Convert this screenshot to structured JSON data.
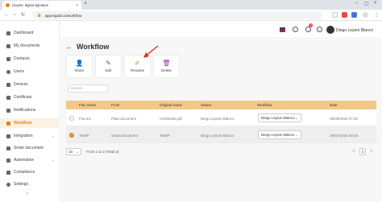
{
  "browser": {
    "tab_title": "Lleyeto: digital signature",
    "url": "app.legado.io/workflow"
  },
  "sidebar": {
    "items": [
      {
        "label": "Dashboard",
        "icon": "grid-icon"
      },
      {
        "label": "My documents",
        "icon": "folder-icon"
      },
      {
        "label": "Contacts",
        "icon": "contacts-icon"
      },
      {
        "label": "Users",
        "icon": "user-icon"
      },
      {
        "label": "Devices",
        "icon": "device-icon"
      },
      {
        "label": "Certificate",
        "icon": "certificate-icon"
      },
      {
        "label": "Notifications",
        "icon": "bell-icon"
      },
      {
        "label": "Workflow",
        "icon": "workflow-icon",
        "active": true
      },
      {
        "label": "Integration",
        "icon": "integration-icon",
        "expandable": true
      },
      {
        "label": "Smart document",
        "icon": "smart-document-icon"
      },
      {
        "label": "Automation",
        "icon": "automation-icon",
        "expandable": true
      },
      {
        "label": "Compliance",
        "icon": "compliance-icon"
      },
      {
        "label": "Settings",
        "icon": "gear-icon"
      }
    ],
    "collapse_icon": "chevron-left-icon"
  },
  "header": {
    "user_name": "Diego Leyton Blanco",
    "notification_count": "2",
    "language_flag": "us-flag-icon"
  },
  "page": {
    "title": "Workflow",
    "actions": [
      {
        "label": "Share",
        "icon": "share-user-icon"
      },
      {
        "label": "Edit",
        "icon": "edit-icon"
      },
      {
        "label": "Rename",
        "icon": "rename-icon"
      },
      {
        "label": "Delete",
        "icon": "delete-icon"
      }
    ],
    "search_placeholder": "Search"
  },
  "table": {
    "columns": [
      "Flux name",
      "From",
      "Original name",
      "Owner",
      "Workflow",
      "Date"
    ],
    "rows": [
      {
        "selected": false,
        "flux_name": "Flux Ex",
        "from": "Plain document",
        "original_name": "Certificate.pdf",
        "owner": "Diego Leyton Blanco",
        "workflow": "Diego Leyton Blanco",
        "date": "05/09/2023 07:02"
      },
      {
        "selected": true,
        "flux_name": "TEMP",
        "from": "Smart document",
        "original_name": "TEMP",
        "owner": "Diego Leyton Blanco",
        "workflow": "Diego Leyton Blanco",
        "date": "29/07/2024 09:49"
      }
    ]
  },
  "pagination": {
    "page_size": "10",
    "range_text": "From 1 to 2 (Total 2)",
    "current_page": "1",
    "prev_label": "<",
    "next_label": ">"
  },
  "colors": {
    "accent": "#e0851b",
    "table_header": "#f3c88a",
    "action_icon": "#8e3aa3"
  }
}
